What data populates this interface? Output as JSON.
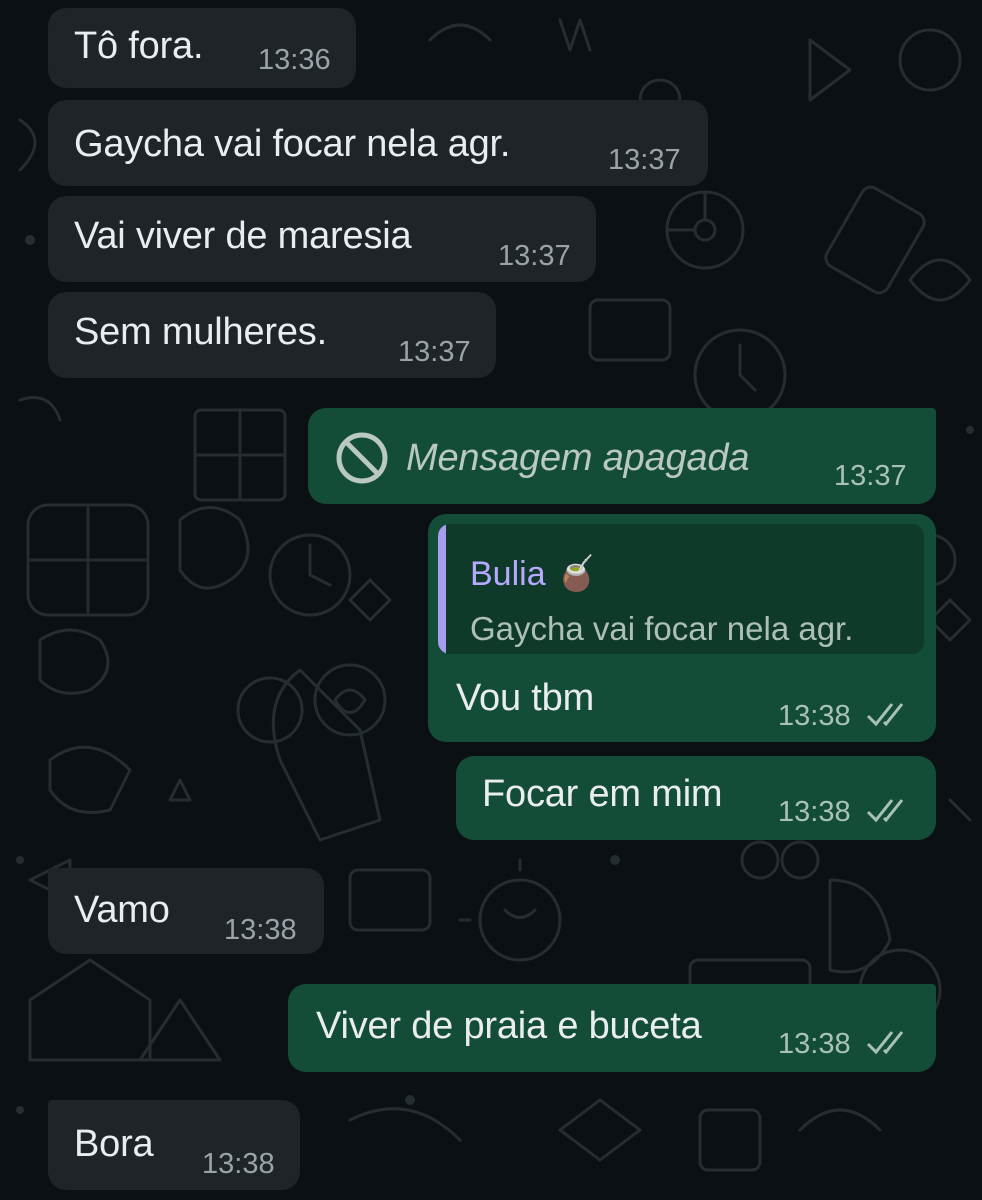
{
  "colors": {
    "background": "#0b1014",
    "incoming_bubble": "#1f2428",
    "outgoing_bubble": "#144d37",
    "quote_bar": "#a79cf0",
    "quote_author": "#b7a9ff"
  },
  "messages": [
    {
      "direction": "in",
      "text": "Tô fora.",
      "time": "13:36"
    },
    {
      "direction": "in",
      "text": "Gaycha vai focar nela agr.",
      "time": "13:37"
    },
    {
      "direction": "in",
      "text": "Vai viver de maresia",
      "time": "13:37"
    },
    {
      "direction": "in",
      "text": "Sem mulheres.",
      "time": "13:37"
    },
    {
      "direction": "out",
      "text": "Mensagem apagada",
      "time": "13:37",
      "deleted": true,
      "icon": "deleted-icon"
    },
    {
      "direction": "out",
      "text": "Vou tbm",
      "time": "13:38",
      "status": "double-check-icon",
      "quote": {
        "author": "Bulia 🧉",
        "text": "Gaycha vai focar nela agr."
      }
    },
    {
      "direction": "out",
      "text": "Focar em mim",
      "time": "13:38",
      "status": "double-check-icon"
    },
    {
      "direction": "in",
      "text": "Vamo",
      "time": "13:38"
    },
    {
      "direction": "out",
      "text": "Viver de praia e buceta",
      "time": "13:38",
      "status": "double-check-icon"
    },
    {
      "direction": "in",
      "text": "Bora",
      "time": "13:38"
    }
  ]
}
